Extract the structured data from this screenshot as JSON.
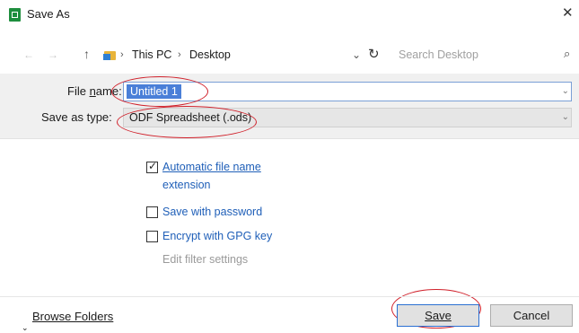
{
  "window": {
    "title": "Save As",
    "close_glyph": "✕"
  },
  "nav": {
    "back_icon": "←",
    "forward_icon": "→",
    "up_icon": "↑",
    "breadcrumb_sep": "›",
    "breadcrumbs": [
      "This PC",
      "Desktop"
    ],
    "dropdown_icon": "⌄",
    "refresh_icon": "↻",
    "search_placeholder": "Search Desktop",
    "search_icon": "⌕"
  },
  "form": {
    "file_name_label_prefix": "File ",
    "file_name_label_mnemonic": "n",
    "file_name_label_suffix": "ame:",
    "file_name_value": "Untitled 1",
    "save_type_label": "Save as type:",
    "save_type_value": "ODF Spreadsheet (.ods)",
    "dropdown_chevron": "⌄"
  },
  "options": [
    {
      "label_line1": "Automatic file name",
      "label_line2": "extension",
      "checked": true,
      "enabled": true
    },
    {
      "label": "Save with password",
      "checked": false,
      "enabled": true
    },
    {
      "label": "Encrypt with GPG key",
      "checked": false,
      "enabled": true
    },
    {
      "label": "Edit filter settings",
      "checked": false,
      "enabled": false
    }
  ],
  "footer": {
    "browse_chevron": "⌄",
    "browse_folders": "Browse Folders",
    "save": "Save",
    "cancel": "Cancel"
  },
  "colors": {
    "annotation": "#d0202a",
    "selection": "#4a7fd8",
    "link_text": "#1f5fb8"
  }
}
